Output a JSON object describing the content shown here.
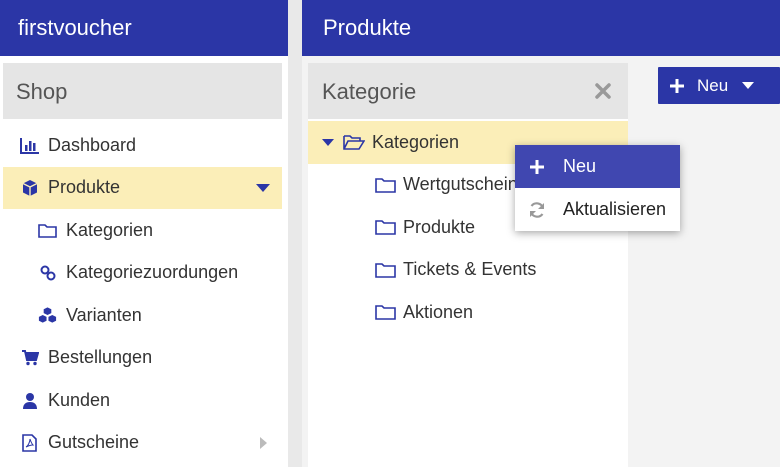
{
  "app": {
    "title": "firstvoucher"
  },
  "page": {
    "title": "Produkte"
  },
  "sidebar": {
    "header": "Shop",
    "items": [
      {
        "label": "Dashboard",
        "icon": "bar-chart-icon"
      },
      {
        "label": "Produkte",
        "icon": "cube-icon",
        "active": true
      },
      {
        "label": "Kategorien",
        "icon": "folder-icon"
      },
      {
        "label": "Kategoriezuordungen",
        "icon": "link-icon"
      },
      {
        "label": "Varianten",
        "icon": "cubes-icon"
      },
      {
        "label": "Bestellungen",
        "icon": "cart-icon"
      },
      {
        "label": "Kunden",
        "icon": "user-icon"
      },
      {
        "label": "Gutscheine",
        "icon": "file-pdf-icon"
      }
    ]
  },
  "category_panel": {
    "header": "Kategorie",
    "root": "Kategorien",
    "children": [
      "Wertgutscheine",
      "Produkte",
      "Tickets & Events",
      "Aktionen"
    ]
  },
  "toolbar": {
    "new_label": "Neu"
  },
  "context_menu": {
    "items": [
      "Neu",
      "Aktualisieren"
    ]
  },
  "colors": {
    "primary": "#2b36a6",
    "active_bg": "#fbeeb8",
    "menu_highlight": "#4047b0"
  }
}
